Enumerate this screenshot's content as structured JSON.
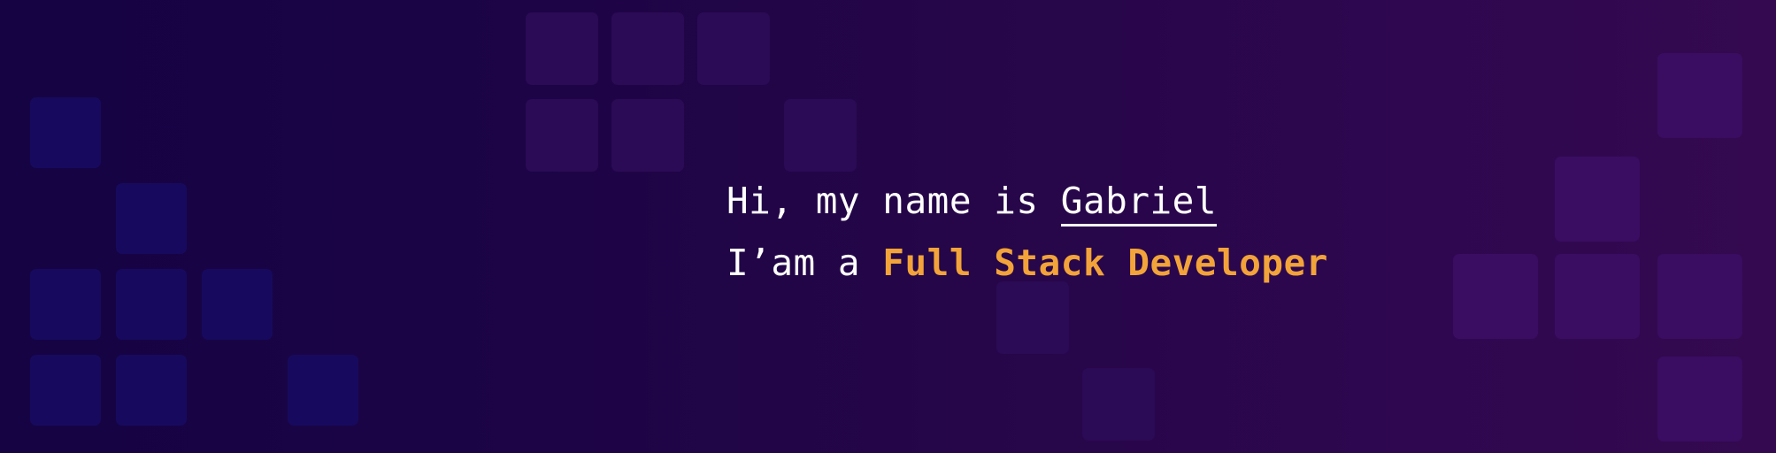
{
  "intro": {
    "greeting_prefix": "Hi, my name is ",
    "name": "Gabriel",
    "role_prefix": "I’am a ",
    "role": "Full Stack Developer"
  },
  "colors": {
    "accent": "#f2a33a",
    "text": "#ffffff",
    "background_left": "#150344",
    "background_right": "#34094f"
  }
}
